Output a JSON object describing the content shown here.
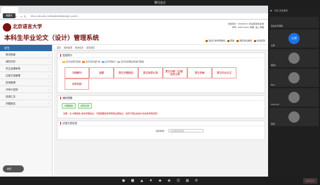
{
  "meeting": {
    "title": "腾讯会议"
  },
  "browser": {
    "tab_label": "",
    "tooltip": "收藏书",
    "url": "bhu.ccutc.edu.cn/bhu/bsinfo/stulogin_uuid=..."
  },
  "header": {
    "uni_name": "北京语言大学",
    "system_name": "本科生毕业论文（设计）管理系统",
    "user_line1": "当前用户: 18041811 欢迎使用本系统",
    "user_line2": "学年: 2020-2021 学期: 第二学期",
    "links": [
      "退出与非学者角色",
      "帮助",
      "通知消息推送",
      "修改密码"
    ]
  },
  "sidebar": {
    "title": "学生",
    "items": [
      "首页指南",
      "我的任务",
      "学生选课审核",
      "过程文档管理",
      "答辩管理",
      "评审与答辩",
      "成绩汇总",
      "开题报告"
    ],
    "search_label": "搜索"
  },
  "main": {
    "breadcrumbs": [
      "首页",
      "我的指南",
      "我的任务",
      "答辩题目"
    ],
    "progress_title": "进度提示",
    "legend": [
      "表示这项已完成",
      "表示该步进行中",
      "表示待执行",
      "表示该步骤必须进行审批"
    ],
    "steps": [
      "中期期刊",
      "选题",
      "提交开题报告",
      "提交指导记录",
      "提交中期（过程）检查记录",
      "提交初稿",
      "提交毕业论文",
      "评审答辩"
    ],
    "notice_title": "通知提醒",
    "badges": [
      "中期报告",
      "指导记录"
    ],
    "notice_text": "说明：请 中期报告 发布所需信息，可能需要经导师审核后再提交，如有不明白的地方请咨询学院老师。",
    "history_title": "过程文档信息",
    "advisor_label": "指导教师：",
    "advisor_placeholder": "请选择指导教师"
  },
  "participants": {
    "header": "讨论 正在讲话",
    "tiles": [
      {
        "name": "正在共享屏幕",
        "type": "share"
      },
      {
        "name": "大师",
        "type": "initials",
        "initials": "大师"
      },
      {
        "name": "成员1",
        "type": "photo"
      },
      {
        "name": "Max",
        "type": "photo"
      },
      {
        "name": "Summer",
        "type": "photo"
      },
      {
        "name": "同学",
        "type": "photo"
      }
    ]
  },
  "toolbar": {
    "icons": [
      "mic-icon",
      "camera-icon",
      "share-icon",
      "members-icon",
      "chat-icon",
      "record-icon",
      "emoji-icon",
      "apps-icon",
      "settings-icon"
    ],
    "leave_label": "结束会议"
  }
}
